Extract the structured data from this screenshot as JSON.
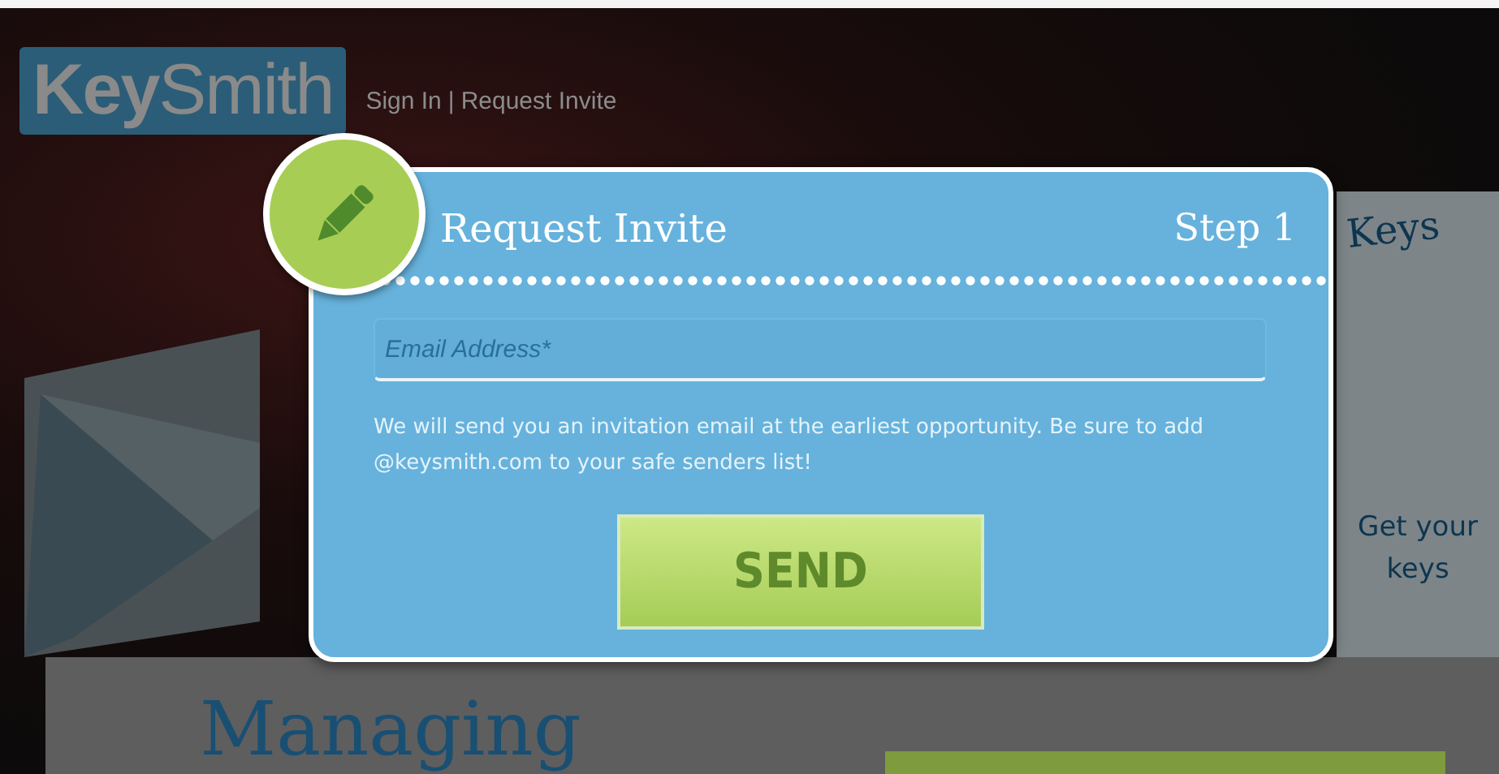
{
  "header": {
    "logo": "**Key**Smith",
    "nav": [
      {
        "label": "Sign In"
      },
      {
        "label": "Request Invite"
      }
    ],
    "nav_separator": "|"
  },
  "background": {
    "side_heading": "Keys",
    "side_link": "Get your keys",
    "heading": "Managing"
  },
  "dialog": {
    "title": "Request Invite",
    "step": "Step 1",
    "email": {
      "placeholder": "Email Address*"
    },
    "note": "We will send you an invitation email at the earliest opportunity. Be sure to add @keysmith.com to your safe senders list!",
    "button": "SEND"
  }
}
